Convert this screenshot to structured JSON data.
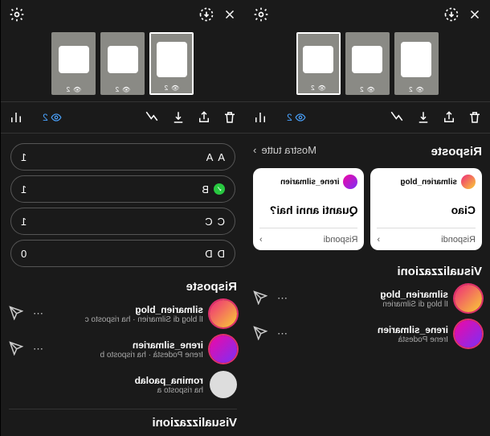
{
  "left": {
    "views_count": "2",
    "poll": [
      {
        "letter": "A",
        "label": "A",
        "count": "1",
        "check": false
      },
      {
        "letter": "B",
        "label": "B",
        "count": "1",
        "check": true
      },
      {
        "letter": "C",
        "label": "C",
        "count": "1",
        "check": false
      },
      {
        "letter": "D",
        "label": "D",
        "count": "0",
        "check": false
      }
    ],
    "risposte": "Risposte",
    "responses": [
      {
        "name": "silmarien_blog",
        "sub": "Il blog di Silmarien · ha risposto c",
        "ring": true,
        "send": true
      },
      {
        "name": "irene_silmarien",
        "sub": "Irene Podestà · ha risposto b",
        "ring": true,
        "send": true
      },
      {
        "name": "romina_paolab",
        "sub": "ha risposto a",
        "ring": false,
        "send": false
      }
    ],
    "viz": "Visualizzazioni"
  },
  "right": {
    "views_count": "2",
    "mostra": "Mostra tutte",
    "risposte": "Risposte",
    "answers": [
      {
        "user": "silmarien_blog",
        "text": "Ciao",
        "foot": "Rispondi"
      },
      {
        "user": "irene_silmarien",
        "text": "Quanti anni hai?",
        "foot": "Rispondi"
      }
    ],
    "viz": "Visualizzazioni",
    "viewers": [
      {
        "name": "silmarien_blog",
        "sub": "Il blog di Silmarien",
        "ring": true
      },
      {
        "name": "irene_silmarien",
        "sub": "Irene Podestà",
        "ring": true
      }
    ]
  },
  "thumb_stat": "2"
}
